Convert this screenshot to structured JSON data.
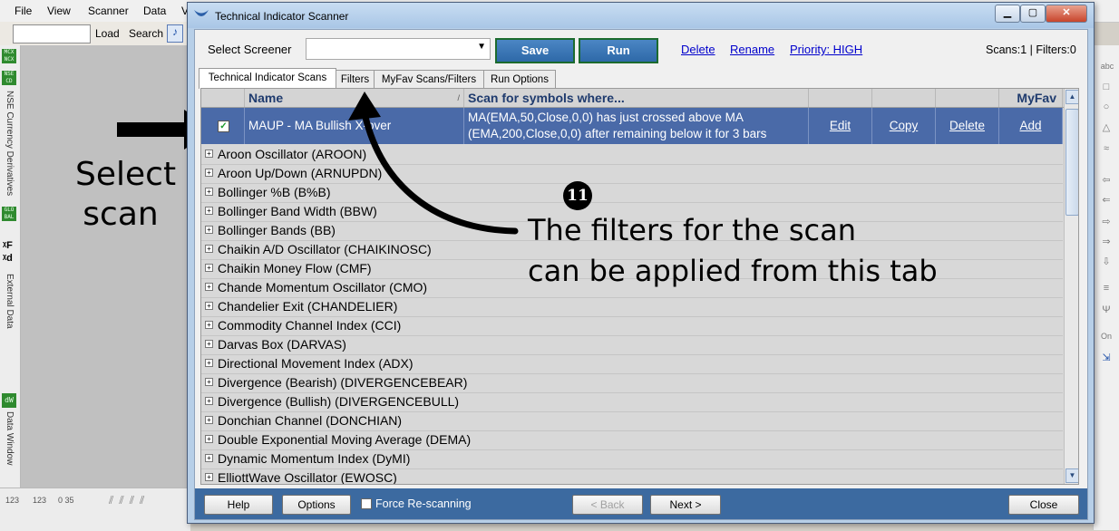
{
  "background_app": {
    "menu": [
      "File",
      "View",
      "Scanner",
      "Data",
      "V"
    ],
    "toolbar": {
      "load_label": "Load",
      "search_label": "Search"
    },
    "left_strip": {
      "icons": [
        "MCX NCX",
        "NSE CD",
        "GLO BAL"
      ],
      "labels": [
        "NSE Currency Derivatives",
        "External Data",
        "Data Window"
      ]
    },
    "right_strip_icons": [
      "abc"
    ],
    "bottom_toolbar": [
      "123",
      "123",
      "0 35"
    ]
  },
  "annotation": {
    "select_line1": "Select",
    "select_line2": "scan",
    "step_number": "11",
    "filters_line1": "The filters for the scan",
    "filters_line2": "can be applied from this tab"
  },
  "dialog": {
    "title": "Technical Indicator Scanner",
    "select_screener_label": "Select Screener",
    "screener_value": "",
    "save_label": "Save",
    "run_label": "Run",
    "links": {
      "delete": "Delete",
      "rename": "Rename",
      "priority": "Priority: HIGH"
    },
    "stats": "Scans:1 | Filters:0",
    "tabs": [
      "Technical Indicator Scans",
      "Filters",
      "MyFav Scans/Filters",
      "Run Options"
    ],
    "grid": {
      "headers": {
        "name": "Name",
        "sort_marker": "/",
        "scan": "Scan for symbols where...",
        "myfav": "MyFav"
      },
      "selected": {
        "name": "MAUP - MA Bullish X-over",
        "scan_line1": "MA(EMA,50,Close,0,0) has just crossed above MA",
        "scan_line2": "(EMA,200,Close,0,0) after remaining below it for 3 bars",
        "edit": "Edit",
        "copy": "Copy",
        "delete": "Delete",
        "add": "Add"
      },
      "rows": [
        "Aroon Oscillator (AROON)",
        "Aroon Up/Down (ARNUPDN)",
        "Bollinger %B (B%B)",
        "Bollinger Band Width (BBW)",
        "Bollinger Bands (BB)",
        "Chaikin A/D Oscillator (CHAIKINOSC)",
        "Chaikin Money Flow (CMF)",
        "Chande Momentum Oscillator (CMO)",
        "Chandelier Exit (CHANDELIER)",
        "Commodity Channel Index (CCI)",
        "Darvas Box (DARVAS)",
        "Directional Movement Index (ADX)",
        "Divergence (Bearish) (DIVERGENCEBEAR)",
        "Divergence (Bullish) (DIVERGENCEBULL)",
        "Donchian Channel (DONCHIAN)",
        "Double Exponential Moving Average (DEMA)",
        "Dynamic Momentum Index (DyMI)",
        "ElliottWave Oscillator (EWOSC)"
      ]
    },
    "footer": {
      "help": "Help",
      "options": "Options",
      "force_label": "Force Re-scanning",
      "back": "< Back",
      "next": "Next >",
      "close": "Close"
    }
  }
}
